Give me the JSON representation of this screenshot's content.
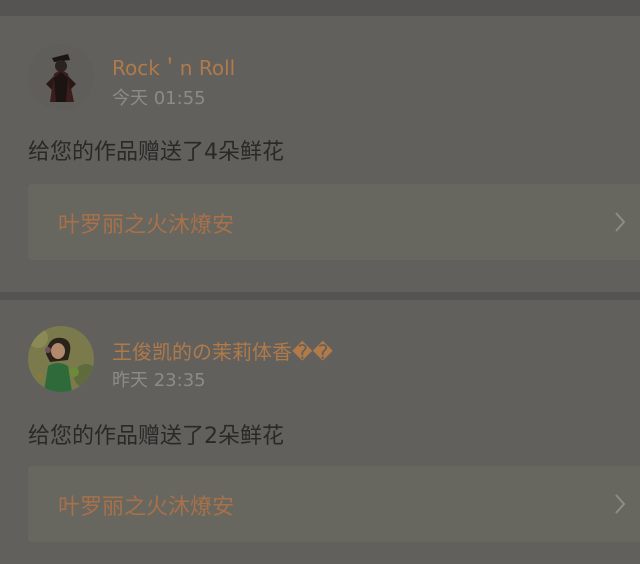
{
  "notifications": [
    {
      "user_name": "Rock＇n Roll",
      "time": "今天 01:55",
      "message": "给您的作品赠送了4朵鲜花",
      "work_title": "叶罗丽之火沐燎安",
      "avatar_icon": "dark-figure-avatar"
    },
    {
      "user_name": "王俊凯的の茉莉体香��",
      "time": "昨天 23:35",
      "message": "给您的作品赠送了2朵鲜花",
      "work_title": "叶罗丽之火沐燎安",
      "avatar_icon": "girl-in-green-avatar"
    }
  ],
  "colors": {
    "name": "#b07a49",
    "time": "#8d8b86",
    "message": "#2a2926",
    "work_title": "#a8714a",
    "card_bg": "#61605d",
    "link_bg": "#67665f"
  },
  "icons": {
    "chevron": "chevron-right-icon"
  }
}
